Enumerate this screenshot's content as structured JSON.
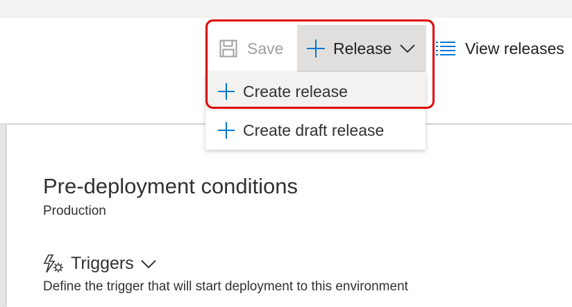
{
  "toolbar": {
    "save_label": "Save",
    "release_label": "Release",
    "view_releases_label": "View releases"
  },
  "release_menu": {
    "items": [
      {
        "label": "Create release",
        "icon": "plus-icon",
        "highlighted": true
      },
      {
        "label": "Create draft release",
        "icon": "plus-icon",
        "highlighted": false
      }
    ]
  },
  "panel": {
    "title": "Pre-deployment conditions",
    "subtitle": "Production",
    "section": {
      "label": "Triggers",
      "icon": "trigger-icon",
      "description": "Define the trigger that will start deployment to this environment"
    }
  },
  "colors": {
    "accent": "#0078d4",
    "highlight_border": "#e00000",
    "disabled_text": "#a19f9d",
    "menu_hover": "#f3f2f1",
    "button_active": "#e1dfdd"
  }
}
